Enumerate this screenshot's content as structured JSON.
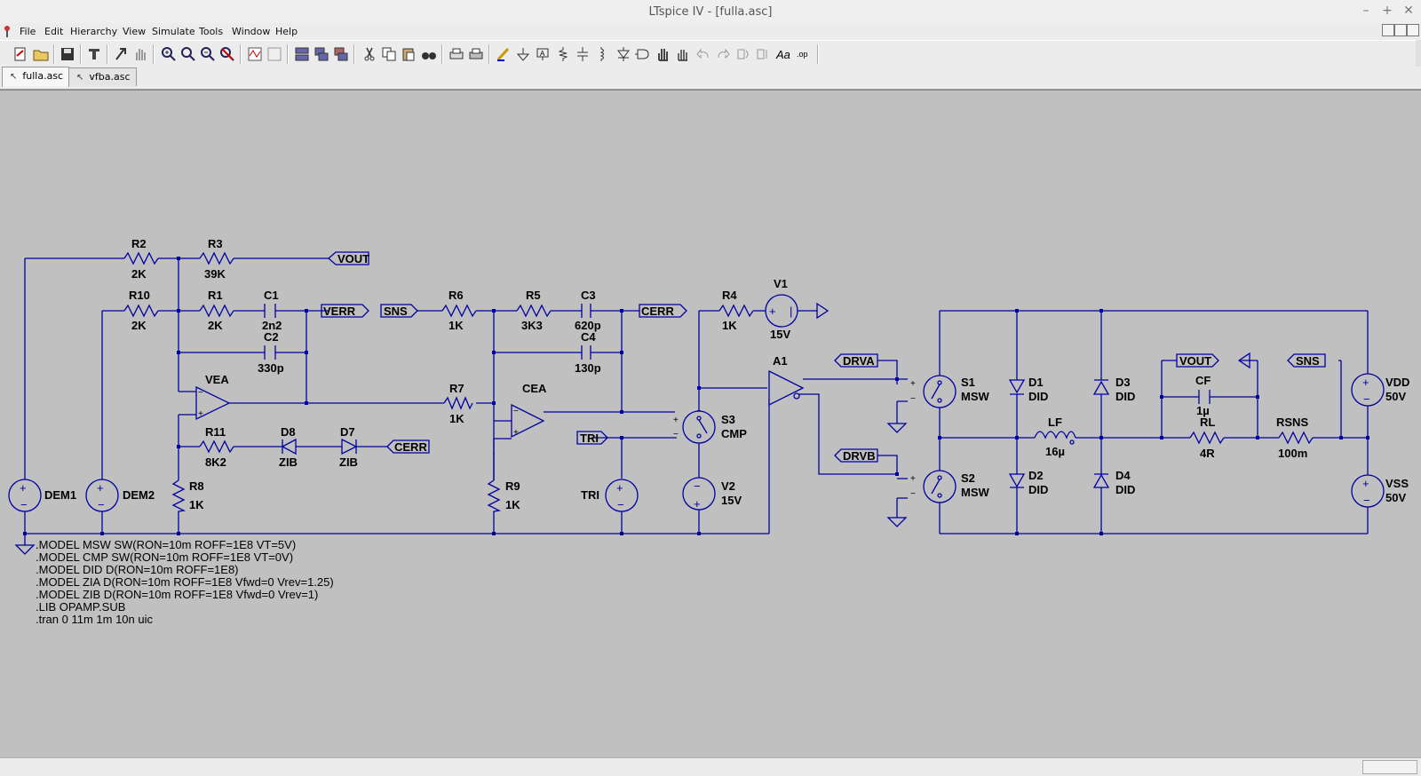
{
  "window": {
    "title": "LTspice IV - [fulla.asc]",
    "controls": [
      "–",
      "+",
      "✕"
    ]
  },
  "menu": [
    "File",
    "Edit",
    "Hierarchy",
    "View",
    "Simulate",
    "Tools",
    "Window",
    "Help"
  ],
  "tabs": [
    {
      "label": "fulla.asc",
      "active": true
    },
    {
      "label": "vfba.asc",
      "active": false
    }
  ],
  "colors": {
    "wire": "#0000a0",
    "canvas": "#c0c0c0",
    "text": "#000000"
  },
  "schematic": {
    "components": {
      "R2": "R2",
      "R2_val": "2K",
      "R3": "R3",
      "R3_val": "39K",
      "R10": "R10",
      "R10_val": "2K",
      "R1": "R1",
      "R1_val": "2K",
      "C1": "C1",
      "C1_val": "2n2",
      "C2": "C2",
      "C2_val": "330p",
      "R6": "R6",
      "R6_val": "1K",
      "R5": "R5",
      "R5_val": "3K3",
      "C3": "C3",
      "C3_val": "620p",
      "C4": "C4",
      "C4_val": "130p",
      "R4": "R4",
      "R4_val": "1K",
      "V1": "V1",
      "V1_val": "15V",
      "A1": "A1",
      "VEA": "VEA",
      "CEA": "CEA",
      "R7": "R7",
      "R7_val": "1K",
      "R11": "R11",
      "R11_val": "8K2",
      "D8": "D8",
      "D8_val": "ZIB",
      "D7": "D7",
      "D7_val": "ZIB",
      "R8": "R8",
      "R8_val": "1K",
      "R9": "R9",
      "R9_val": "1K",
      "S3": "S3",
      "S3_val": "CMP",
      "V2": "V2",
      "V2_val": "15V",
      "TRI": "TRI",
      "DEM1": "DEM1",
      "DEM2": "DEM2",
      "S1": "S1",
      "S1_val": "MSW",
      "S2": "S2",
      "S2_val": "MSW",
      "D1": "D1",
      "D1_val": "DID",
      "D2": "D2",
      "D2_val": "DID",
      "D3": "D3",
      "D3_val": "DID",
      "D4": "D4",
      "D4_val": "DID",
      "LF": "LF",
      "LF_val": "16µ",
      "CF": "CF",
      "CF_val": "1µ",
      "RL": "RL",
      "RL_val": "4R",
      "RSNS": "RSNS",
      "RSNS_val": "100m",
      "VDD": "VDD",
      "VDD_val": "50V",
      "VSS": "VSS",
      "VSS_val": "50V"
    },
    "netlabels": {
      "vout1": "VOUT",
      "verr": "VERR",
      "sns1": "SNS",
      "cerr1": "CERR",
      "cerr2": "CERR",
      "tri": "TRI",
      "drva": "DRVA",
      "drvb": "DRVB",
      "vout2": "VOUT",
      "sns2": "SNS"
    },
    "directives": [
      ".MODEL MSW SW(RON=10m ROFF=1E8 VT=5V)",
      ".MODEL CMP SW(RON=10m ROFF=1E8 VT=0V)",
      ".MODEL DID D(RON=10m ROFF=1E8)",
      ".MODEL ZIA D(RON=10m ROFF=1E8 Vfwd=0 Vrev=1.25)",
      ".MODEL ZIB D(RON=10m ROFF=1E8 Vfwd=0 Vrev=1)",
      ".LIB OPAMP.SUB",
      ".tran 0 11m 1m 10n uic"
    ]
  }
}
